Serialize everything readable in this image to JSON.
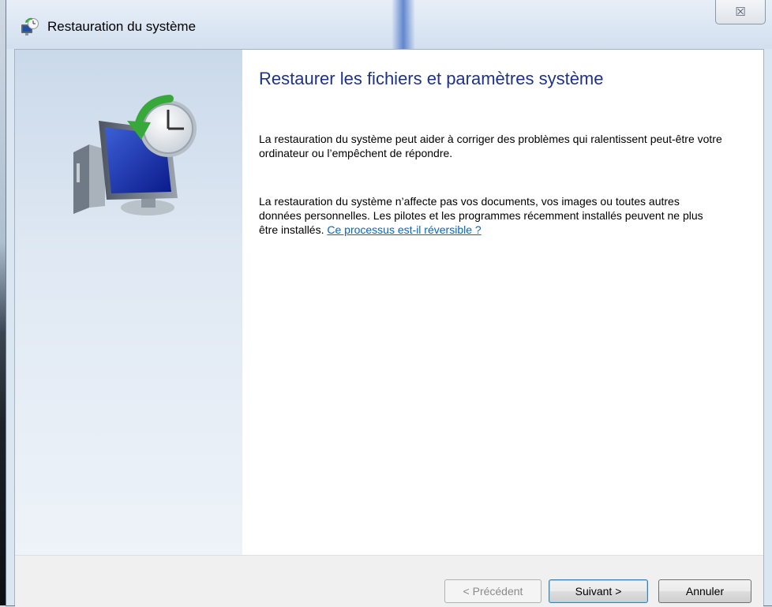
{
  "window": {
    "title": "Restauration du système",
    "close_label": "☒"
  },
  "main": {
    "heading": "Restaurer les fichiers et paramètres système",
    "paragraph1": "La restauration du système peut aider à corriger des problèmes qui ralentissent peut-être votre ordinateur ou l’empêchent de répondre.",
    "paragraph2_text": "La restauration du système n’affecte pas vos documents, vos images ou toutes autres données personnelles. Les pilotes et les programmes récemment installés peuvent ne plus être installés. ",
    "paragraph2_link": "Ce processus est-il réversible ?"
  },
  "footer": {
    "prev_label": "< Précédent",
    "next_label": "Suivant >",
    "cancel_label": "Annuler"
  },
  "icons": {
    "title_icon": "system-restore-icon",
    "illustration": "system-restore-monitor-clock-icon"
  },
  "colors": {
    "heading": "#1e3287",
    "link": "#0066cc",
    "sidebar": "#cad9ea"
  }
}
